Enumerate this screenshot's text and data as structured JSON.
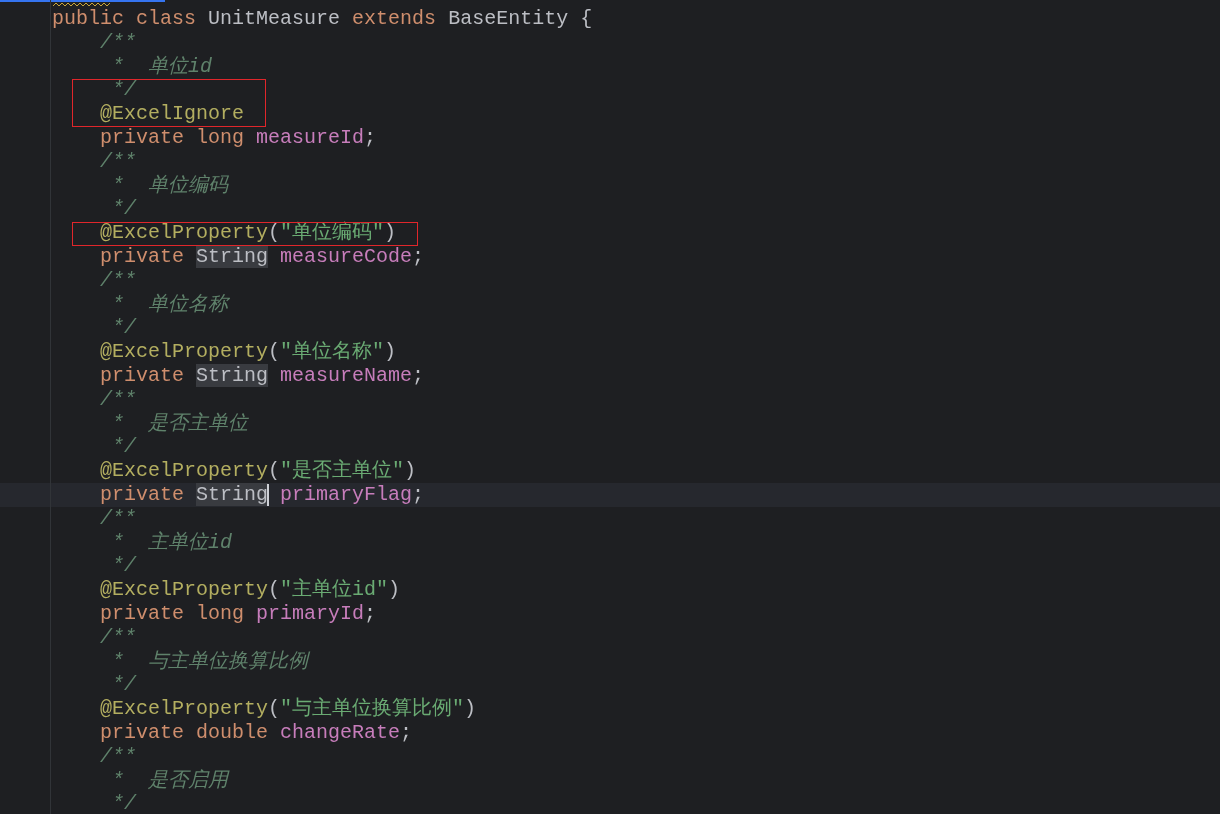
{
  "progress_bar": {
    "level": 0.135
  },
  "editor": {
    "lines": [
      {
        "kind": "declaration",
        "boxed": false,
        "current": false,
        "tokens": [
          {
            "text": "public",
            "kind": "keyword"
          },
          {
            "text": "class",
            "kind": "keyword"
          },
          {
            "text": "UnitMeasure",
            "kind": "plain"
          },
          {
            "text": "extends",
            "kind": "keyword"
          },
          {
            "text": "BaseEntity",
            "kind": "plain"
          },
          {
            "text": "{",
            "kind": "plain"
          }
        ]
      },
      {
        "kind": "member",
        "boxed": false,
        "current": false,
        "tokens": [
          {
            "text": "/**",
            "kind": "comment"
          }
        ]
      },
      {
        "kind": "doc_body",
        "boxed": false,
        "current": false,
        "tokens": [
          {
            "text": "*  单位id",
            "kind": "comment"
          }
        ]
      },
      {
        "kind": "doc_body",
        "boxed": true,
        "current": false,
        "tokens": [
          {
            "text": "*/",
            "kind": "comment"
          }
        ]
      },
      {
        "kind": "member",
        "boxed": true,
        "current": false,
        "tokens": [
          {
            "text": "@ExcelIgnore",
            "kind": "annotation"
          }
        ]
      },
      {
        "kind": "member",
        "boxed": false,
        "current": false,
        "tokens": [
          {
            "text": "private",
            "kind": "keyword"
          },
          {
            "text": "long",
            "kind": "keyword"
          },
          {
            "text": "measureId",
            "kind": "field"
          },
          {
            "text": ";",
            "kind": "punct"
          }
        ]
      },
      {
        "kind": "member",
        "boxed": false,
        "current": false,
        "tokens": [
          {
            "text": "/**",
            "kind": "comment"
          }
        ]
      },
      {
        "kind": "doc_body",
        "boxed": false,
        "current": false,
        "tokens": [
          {
            "text": "*  单位编码",
            "kind": "comment"
          }
        ]
      },
      {
        "kind": "doc_body",
        "boxed": false,
        "current": false,
        "tokens": [
          {
            "text": "*/",
            "kind": "comment"
          }
        ]
      },
      {
        "kind": "member",
        "boxed": true,
        "current": false,
        "tokens": [
          {
            "text": "@ExcelProperty",
            "kind": "annotation"
          },
          {
            "text": "(",
            "kind": "punct"
          },
          {
            "text": "\"单位编码\"",
            "kind": "string"
          },
          {
            "text": ")",
            "kind": "punct"
          }
        ]
      },
      {
        "kind": "member",
        "boxed": false,
        "current": false,
        "tokens": [
          {
            "text": "private",
            "kind": "keyword"
          },
          {
            "text": "String",
            "kind": "plain",
            "highlighted": true
          },
          {
            "text": "measureCode",
            "kind": "field"
          },
          {
            "text": ";",
            "kind": "punct"
          }
        ]
      },
      {
        "kind": "member",
        "boxed": false,
        "current": false,
        "tokens": [
          {
            "text": "/**",
            "kind": "comment"
          }
        ]
      },
      {
        "kind": "doc_body",
        "boxed": false,
        "current": false,
        "tokens": [
          {
            "text": "*  单位名称",
            "kind": "comment"
          }
        ]
      },
      {
        "kind": "doc_body",
        "boxed": false,
        "current": false,
        "tokens": [
          {
            "text": "*/",
            "kind": "comment"
          }
        ]
      },
      {
        "kind": "member",
        "boxed": false,
        "current": false,
        "tokens": [
          {
            "text": "@ExcelProperty",
            "kind": "annotation"
          },
          {
            "text": "(",
            "kind": "punct"
          },
          {
            "text": "\"单位名称\"",
            "kind": "string"
          },
          {
            "text": ")",
            "kind": "punct"
          }
        ]
      },
      {
        "kind": "member",
        "boxed": false,
        "current": false,
        "tokens": [
          {
            "text": "private",
            "kind": "keyword"
          },
          {
            "text": "String",
            "kind": "plain",
            "highlighted": true
          },
          {
            "text": "measureName",
            "kind": "field"
          },
          {
            "text": ";",
            "kind": "punct"
          }
        ]
      },
      {
        "kind": "member",
        "boxed": false,
        "current": false,
        "tokens": [
          {
            "text": "/**",
            "kind": "comment"
          }
        ]
      },
      {
        "kind": "doc_body",
        "boxed": false,
        "current": false,
        "tokens": [
          {
            "text": "*  是否主单位",
            "kind": "comment"
          }
        ]
      },
      {
        "kind": "doc_body",
        "boxed": false,
        "current": false,
        "tokens": [
          {
            "text": "*/",
            "kind": "comment"
          }
        ]
      },
      {
        "kind": "member",
        "boxed": false,
        "current": false,
        "tokens": [
          {
            "text": "@ExcelProperty",
            "kind": "annotation"
          },
          {
            "text": "(",
            "kind": "punct"
          },
          {
            "text": "\"是否主单位\"",
            "kind": "string"
          },
          {
            "text": ")",
            "kind": "punct"
          }
        ]
      },
      {
        "kind": "member",
        "boxed": false,
        "current": true,
        "tokens": [
          {
            "text": "private",
            "kind": "keyword"
          },
          {
            "text": "String",
            "kind": "plain",
            "highlighted": true,
            "caret": true
          },
          {
            "text": "primaryFlag",
            "kind": "field"
          },
          {
            "text": ";",
            "kind": "punct"
          }
        ]
      },
      {
        "kind": "member",
        "boxed": false,
        "current": false,
        "tokens": [
          {
            "text": "/**",
            "kind": "comment"
          }
        ]
      },
      {
        "kind": "doc_body",
        "boxed": false,
        "current": false,
        "tokens": [
          {
            "text": "*  主单位id",
            "kind": "comment"
          }
        ]
      },
      {
        "kind": "doc_body",
        "boxed": false,
        "current": false,
        "tokens": [
          {
            "text": "*/",
            "kind": "comment"
          }
        ]
      },
      {
        "kind": "member",
        "boxed": false,
        "current": false,
        "tokens": [
          {
            "text": "@ExcelProperty",
            "kind": "annotation"
          },
          {
            "text": "(",
            "kind": "punct"
          },
          {
            "text": "\"主单位id\"",
            "kind": "string"
          },
          {
            "text": ")",
            "kind": "punct"
          }
        ]
      },
      {
        "kind": "member",
        "boxed": false,
        "current": false,
        "tokens": [
          {
            "text": "private",
            "kind": "keyword"
          },
          {
            "text": "long",
            "kind": "keyword"
          },
          {
            "text": "primaryId",
            "kind": "field"
          },
          {
            "text": ";",
            "kind": "punct"
          }
        ]
      },
      {
        "kind": "member",
        "boxed": false,
        "current": false,
        "tokens": [
          {
            "text": "/**",
            "kind": "comment"
          }
        ]
      },
      {
        "kind": "doc_body",
        "boxed": false,
        "current": false,
        "tokens": [
          {
            "text": "*  与主单位换算比例",
            "kind": "comment"
          }
        ]
      },
      {
        "kind": "doc_body",
        "boxed": false,
        "current": false,
        "tokens": [
          {
            "text": "*/",
            "kind": "comment"
          }
        ]
      },
      {
        "kind": "member",
        "boxed": false,
        "current": false,
        "tokens": [
          {
            "text": "@ExcelProperty",
            "kind": "annotation"
          },
          {
            "text": "(",
            "kind": "punct"
          },
          {
            "text": "\"与主单位换算比例\"",
            "kind": "string"
          },
          {
            "text": ")",
            "kind": "punct"
          }
        ]
      },
      {
        "kind": "member",
        "boxed": false,
        "current": false,
        "tokens": [
          {
            "text": "private",
            "kind": "keyword"
          },
          {
            "text": "double",
            "kind": "keyword"
          },
          {
            "text": "changeRate",
            "kind": "field"
          },
          {
            "text": ";",
            "kind": "punct"
          }
        ]
      },
      {
        "kind": "member",
        "boxed": false,
        "current": false,
        "tokens": [
          {
            "text": "/**",
            "kind": "comment"
          }
        ]
      },
      {
        "kind": "doc_body",
        "boxed": false,
        "current": false,
        "tokens": [
          {
            "text": "*  是否启用",
            "kind": "comment"
          }
        ]
      },
      {
        "kind": "doc_body",
        "boxed": false,
        "current": false,
        "tokens": [
          {
            "text": "*/",
            "kind": "comment"
          }
        ]
      }
    ]
  }
}
